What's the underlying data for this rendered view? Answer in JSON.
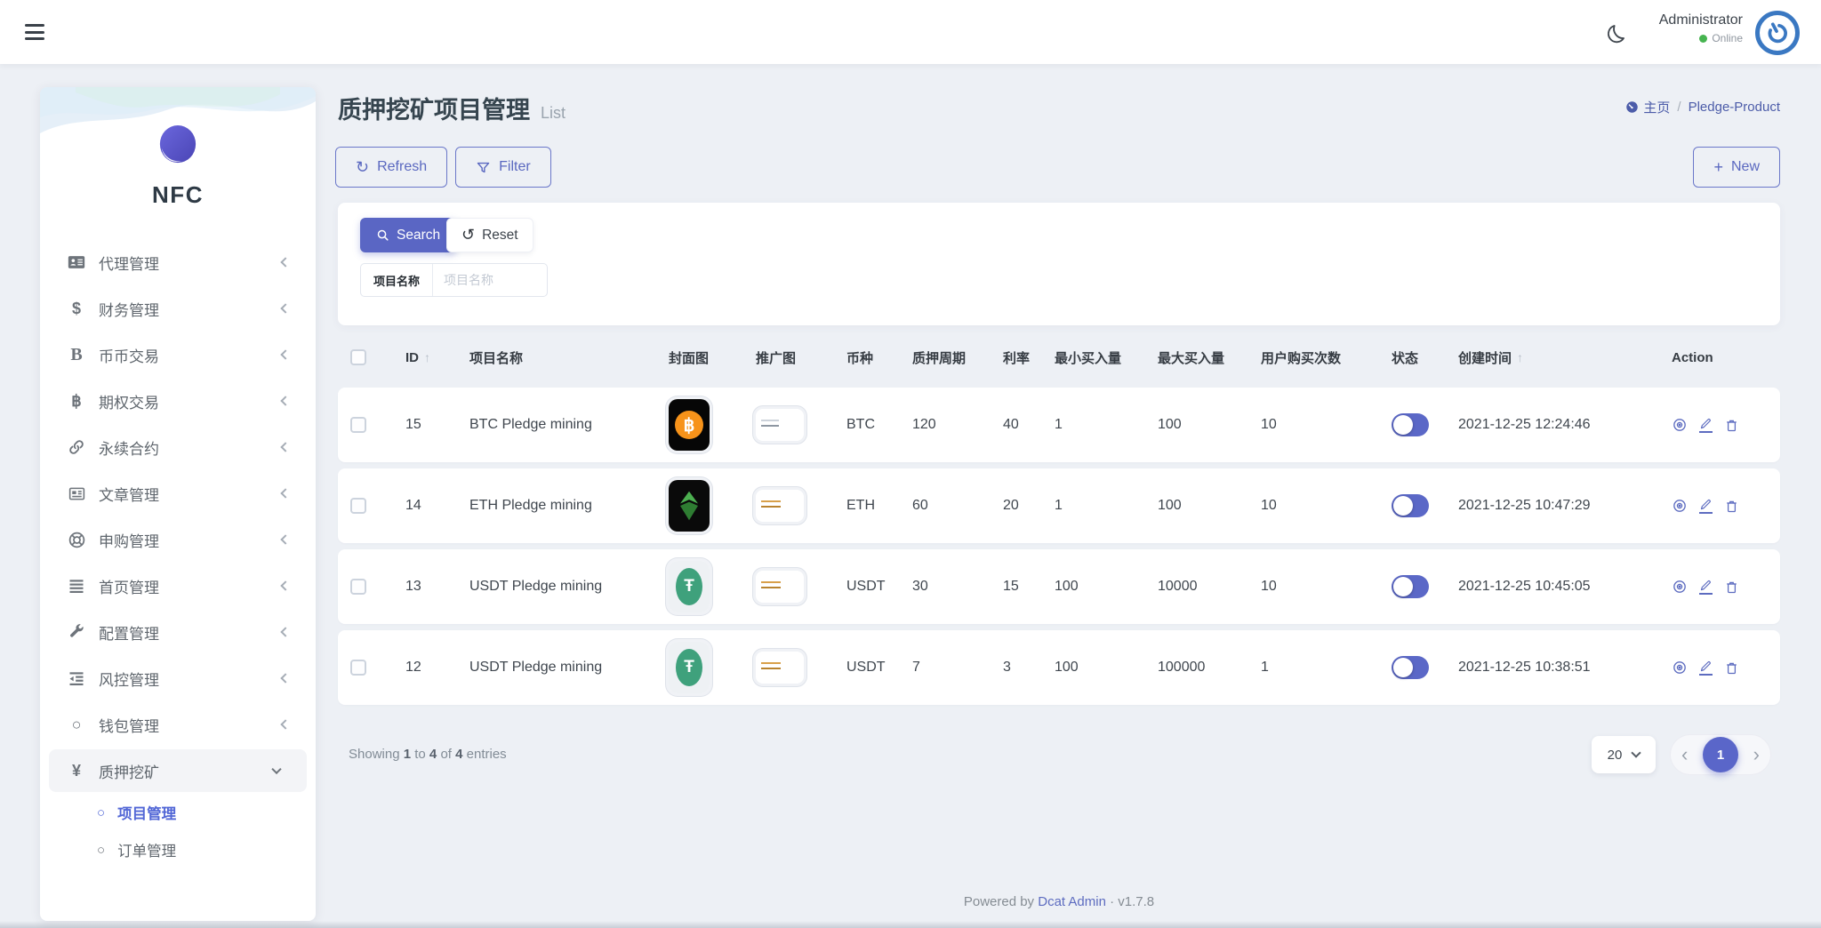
{
  "colors": {
    "accent": "#5a66c4",
    "link": "#5d6cc0",
    "online_green": "#46b450",
    "avatar_blue": "#3a78c2",
    "toggle_on": "#5b68c7",
    "active_menu": "#5166d6"
  },
  "icons": {
    "dollar": "$",
    "bold_b": "B",
    "baht": "฿",
    "circle": "○",
    "yen": "¥",
    "sort_asc": "↑",
    "plus": "+",
    "refresh": "↻",
    "reset": "↺",
    "prev": "‹",
    "next": "›",
    "slash": "/"
  },
  "navbar": {
    "user_name": "Administrator",
    "user_status": "Online"
  },
  "logo": {
    "text": "NFC"
  },
  "breadcrumb": {
    "home": "主页",
    "current": "Pledge-Product"
  },
  "page": {
    "title": "质押挖矿项目管理",
    "subtitle": "List"
  },
  "toolbar": {
    "refresh": "Refresh",
    "filter": "Filter",
    "new": "New"
  },
  "filter_panel": {
    "search": "Search",
    "reset": "Reset",
    "field_label": "项目名称",
    "field_placeholder": "项目名称"
  },
  "sidebar": {
    "items": [
      {
        "icon": "id-card-icon",
        "label": "代理管理"
      },
      {
        "icon": "dollar-icon",
        "label": "财务管理"
      },
      {
        "icon": "letter-b-icon",
        "label": "币币交易"
      },
      {
        "icon": "bitcoin-icon",
        "label": "期权交易"
      },
      {
        "icon": "link-icon",
        "label": "永续合约"
      },
      {
        "icon": "newspaper-icon",
        "label": "文章管理"
      },
      {
        "icon": "life-ring-icon",
        "label": "申购管理"
      },
      {
        "icon": "bars-icon",
        "label": "首页管理"
      },
      {
        "icon": "wrench-icon",
        "label": "配置管理"
      },
      {
        "icon": "outdent-icon",
        "label": "风控管理"
      },
      {
        "icon": "circle-icon",
        "label": "钱包管理"
      },
      {
        "icon": "yen-icon",
        "label": "质押挖矿",
        "expanded": true
      }
    ],
    "submenu": [
      {
        "label": "项目管理",
        "active": true
      },
      {
        "label": "订单管理",
        "active": false
      }
    ]
  },
  "table": {
    "headers": [
      "ID",
      "项目名称",
      "封面图",
      "推广图",
      "币种",
      "质押周期",
      "利率",
      "最小买入量",
      "最大买入量",
      "用户购买次数",
      "状态",
      "创建时间",
      "Action"
    ],
    "rows": [
      {
        "id": "15",
        "name": "BTC Pledge mining",
        "cover": "btc-logo-black-card",
        "promo": "navy-promo-card",
        "coin": "BTC",
        "period": "120",
        "rate": "40",
        "min": "1",
        "max": "100",
        "times": "10",
        "status_on": true,
        "created": "2021-12-25 12:24:46"
      },
      {
        "id": "14",
        "name": "ETH Pledge mining",
        "cover": "eth-logo-black-card",
        "promo": "red-promo-card",
        "coin": "ETH",
        "period": "60",
        "rate": "20",
        "min": "1",
        "max": "100",
        "times": "10",
        "status_on": true,
        "created": "2021-12-25 10:47:29"
      },
      {
        "id": "13",
        "name": "USDT Pledge mining",
        "cover": "usdt-logo-light-card",
        "promo": "red-promo-card",
        "coin": "USDT",
        "period": "30",
        "rate": "15",
        "min": "100",
        "max": "10000",
        "times": "10",
        "status_on": true,
        "created": "2021-12-25 10:45:05"
      },
      {
        "id": "12",
        "name": "USDT Pledge mining",
        "cover": "usdt-logo-light-card",
        "promo": "red-promo-card",
        "coin": "USDT",
        "period": "7",
        "rate": "3",
        "min": "100",
        "max": "100000",
        "times": "1",
        "status_on": true,
        "created": "2021-12-25 10:38:51"
      }
    ]
  },
  "pagination": {
    "showing": "Showing",
    "from": "1",
    "to_word": "to",
    "to": "4",
    "of_word": "of",
    "total": "4",
    "entries_word": "entries",
    "per_page": "20",
    "current_page": "1"
  },
  "footer": {
    "powered_by": "Powered by",
    "brand": "Dcat Admin",
    "separator": "·",
    "version": "v1.7.8"
  }
}
